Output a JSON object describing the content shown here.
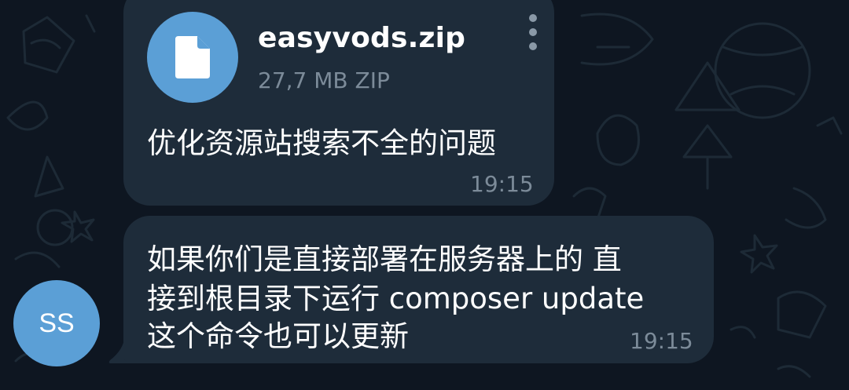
{
  "file_message": {
    "icon": "document-icon",
    "file_name": "easyvods.zip",
    "file_meta": "27,7 MB ZIP",
    "caption": "优化资源站搜索不全的问题",
    "time": "19:15"
  },
  "text_message": {
    "lines": [
      "如果你们是直接部署在服务器上的  直",
      "接到根目录下运行 composer update",
      "这个命令也可以更新"
    ],
    "time": "19:15"
  },
  "sender": {
    "avatar_initials": "SS"
  },
  "colors": {
    "background": "#0e1621",
    "bubble": "#1e2c3a",
    "accent": "#5b9fd6",
    "secondary_text": "#7c8b99"
  }
}
